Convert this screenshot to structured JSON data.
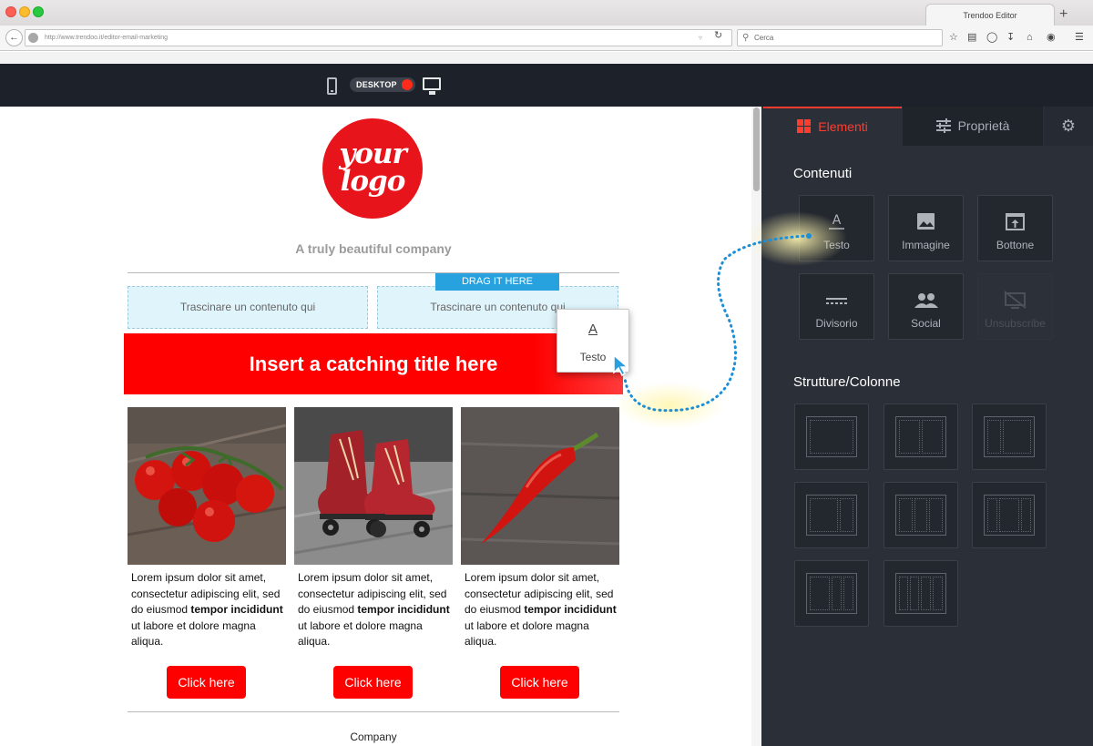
{
  "browser": {
    "tab_title": "Trendoo Editor",
    "new_tab": "+",
    "url": "http://www.trendoo.it/editor-email-marketing",
    "search_placeholder": "Cerca"
  },
  "editor_toolbar": {
    "mode_label": "DESKTOP"
  },
  "email": {
    "logo_line1": "your",
    "logo_line2": "logo",
    "tagline": "A truly beautiful company",
    "drop_zone_left": "Trascinare un contenuto qui",
    "drop_zone_right": "Trascinare un contenuto qui",
    "drag_hint": "DRAG IT HERE",
    "title": "Insert a catching title here",
    "columns": [
      {
        "text_a": "Lorem ipsum dolor sit amet, consectetur adipiscing elit, sed do eiusmod ",
        "text_bold": "tempor incididunt",
        "text_b": " ut labore et dolore magna aliqua.",
        "cta": "Click here"
      },
      {
        "text_a": "Lorem ipsum dolor sit amet, consectetur adipiscing elit, sed do eiusmod ",
        "text_bold": "tempor incididunt",
        "text_b": " ut labore et dolore magna aliqua.",
        "cta": "Click here"
      },
      {
        "text_a": "Lorem ipsum dolor sit amet, consectetur adipiscing elit, sed do eiusmod ",
        "text_bold": "tempor incididunt",
        "text_b": " ut labore et dolore magna aliqua.",
        "cta": "Click here"
      }
    ],
    "footer": "Company"
  },
  "drag_card": {
    "icon": "A",
    "label": "Testo"
  },
  "sidebar": {
    "tabs": {
      "elements": "Elementi",
      "properties": "Proprietà"
    },
    "content_title": "Contenuti",
    "content_items": [
      {
        "label": "Testo",
        "icon": "text-icon"
      },
      {
        "label": "Immagine",
        "icon": "image-icon"
      },
      {
        "label": "Bottone",
        "icon": "button-icon"
      },
      {
        "label": "Divisorio",
        "icon": "divider-icon"
      },
      {
        "label": "Social",
        "icon": "social-icon"
      },
      {
        "label": "Unsubscribe",
        "icon": "unsubscribe-icon"
      }
    ],
    "structures_title": "Strutture/Colonne"
  },
  "colors": {
    "accent": "#ff3d2e",
    "brand_red": "#ff0000",
    "drag_blue": "#27a2df",
    "sidebar_bg": "#2b2f38",
    "editor_bar": "#1d2129"
  }
}
